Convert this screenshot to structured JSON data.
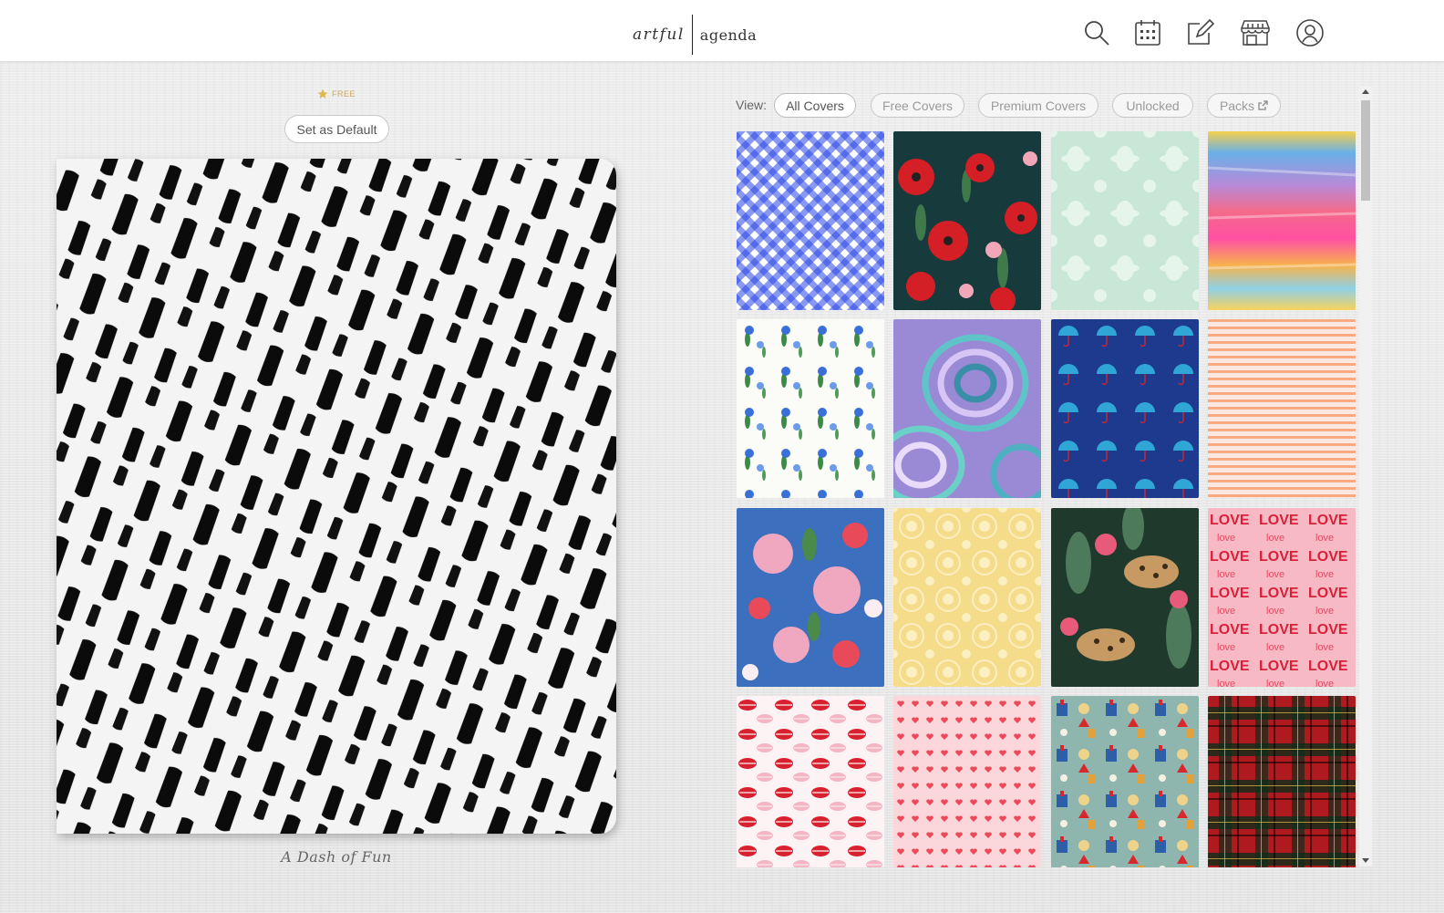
{
  "header": {
    "logo_left": "artful",
    "logo_right": "agenda",
    "icons": [
      "search-icon",
      "calendar-icon",
      "edit-icon",
      "store-icon",
      "account-icon"
    ]
  },
  "preview": {
    "badge": "FREE",
    "set_default_label": "Set as Default",
    "cover_title": "A Dash of Fun"
  },
  "filters": {
    "view_label": "View:",
    "options": [
      "All Covers",
      "Free Covers",
      "Premium Covers",
      "Unlocked",
      "Packs"
    ],
    "active": "All Covers"
  },
  "covers": [
    {
      "pattern": "blue-gingham"
    },
    {
      "pattern": "red-poppies-navy"
    },
    {
      "pattern": "mint-damask"
    },
    {
      "pattern": "rainbow-brushstrokes"
    },
    {
      "pattern": "blue-flower-sprigs"
    },
    {
      "pattern": "purple-teal-agate"
    },
    {
      "pattern": "umbrellas-navy"
    },
    {
      "pattern": "peach-stripes"
    },
    {
      "pattern": "floral-bouquet-blue"
    },
    {
      "pattern": "yellow-medallion"
    },
    {
      "pattern": "leopard-tropical"
    },
    {
      "pattern": "love-typography-pink"
    },
    {
      "pattern": "red-lips"
    },
    {
      "pattern": "pink-hearts"
    },
    {
      "pattern": "holiday-sage"
    },
    {
      "pattern": "red-green-tartan"
    }
  ],
  "colors": {
    "accent_gold": "#c9a961",
    "text_gray": "#555555"
  }
}
